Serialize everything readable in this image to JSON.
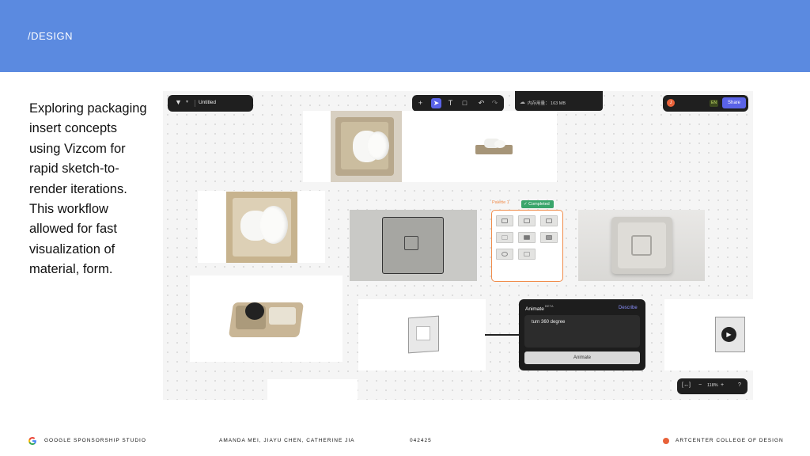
{
  "header": {
    "section_title": "/DESIGN"
  },
  "description": "Exploring packaging insert concepts using Vizcom for rapid sketch-to-render iterations. This workflow allowed for fast visualization of material, form.",
  "app": {
    "file_name": "Untitled",
    "memory_label": "内存用量： 163 MB",
    "avatar_initial": "J",
    "language_badge": "EN",
    "share_label": "Share",
    "zoom_level": "118%",
    "help_label": "?",
    "palette_label": "Palette 1",
    "completed_label": "Completed",
    "animate_title": "Animate",
    "animate_beta": "BETA",
    "describe_label": "Describe",
    "prompt_text": "turn 360 degree",
    "animate_button": "Animate",
    "tools": [
      "plus-icon",
      "select-cursor-icon",
      "text-icon",
      "frame-icon",
      "undo-icon",
      "redo-icon"
    ]
  },
  "footer": {
    "studio": "GOOGLE SPONSORSHIP STUDIO",
    "authors": "AMANDA MEI, JIAYU CHEN, CATHERINE JIA",
    "date_code": "042425",
    "school": "ARTCENTER COLLEGE OF DESIGN"
  },
  "colors": {
    "header_band": "#5b8ae0",
    "accent_purple": "#5a63e8",
    "palette_orange": "#f08c4b",
    "completed_green": "#3aa56b",
    "artcenter_orange": "#e8623a"
  }
}
